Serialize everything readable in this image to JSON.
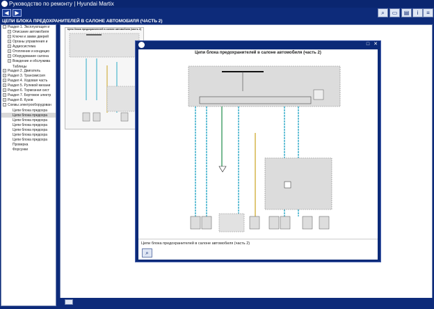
{
  "window": {
    "title": "Руководство по ремонту | Hyundai Martix"
  },
  "toolbar": {
    "back_icon": "arrow-left-icon",
    "forward_icon": "arrow-right-icon",
    "tools": [
      "zoom-icon",
      "image-icon",
      "print-icon",
      "info-icon",
      "menu-icon"
    ]
  },
  "page": {
    "header": "ЦЕПИ БЛОКА ПРЕДОХРАНИТЕЛЕЙ В САЛОНЕ АВТОМОБИЛЯ (ЧАСТЬ 2)"
  },
  "tree": {
    "items": [
      {
        "label": "Раздел 1. Эксплуатация и",
        "toggle": "-",
        "indent": 0
      },
      {
        "label": "Описание автомобиля",
        "toggle": "+",
        "indent": 1
      },
      {
        "label": "Ключи и замки дверей",
        "toggle": "+",
        "indent": 1
      },
      {
        "label": "Органы управления и",
        "toggle": "+",
        "indent": 1
      },
      {
        "label": "Аудиосистема",
        "toggle": "+",
        "indent": 1
      },
      {
        "label": "Отопление и кондицио",
        "toggle": "+",
        "indent": 1
      },
      {
        "label": "Оборудование салона",
        "toggle": "+",
        "indent": 1
      },
      {
        "label": "Вождение и обслужива",
        "toggle": "+",
        "indent": 1
      },
      {
        "label": "Таблицы",
        "toggle": "",
        "indent": 1
      },
      {
        "label": "Раздел 2. Двигатель",
        "toggle": "+",
        "indent": 0
      },
      {
        "label": "Раздел 3. Трансмиссия",
        "toggle": "+",
        "indent": 0
      },
      {
        "label": "Раздел 4. Ходовая часть",
        "toggle": "+",
        "indent": 0
      },
      {
        "label": "Раздел 5. Рулевой механи",
        "toggle": "+",
        "indent": 0
      },
      {
        "label": "Раздел 6. Тормозная сист",
        "toggle": "+",
        "indent": 0
      },
      {
        "label": "Раздел 7. Бортовое электр",
        "toggle": "+",
        "indent": 0
      },
      {
        "label": "Раздел 8. Кузов",
        "toggle": "+",
        "indent": 0
      },
      {
        "label": "Схемы электрооборудован",
        "toggle": "-",
        "indent": 0
      },
      {
        "label": "Цепи блока предохра",
        "toggle": "",
        "indent": 1
      },
      {
        "label": "Цепи блока предохра",
        "toggle": "",
        "indent": 1,
        "selected": true
      },
      {
        "label": "Цепи блока предохра",
        "toggle": "",
        "indent": 1
      },
      {
        "label": "Цепи блока предохра",
        "toggle": "",
        "indent": 1
      },
      {
        "label": "Цепи блока предохра",
        "toggle": "",
        "indent": 1
      },
      {
        "label": "Цепи блока предохра",
        "toggle": "",
        "indent": 1
      },
      {
        "label": "Цепи блока предохра",
        "toggle": "",
        "indent": 1
      },
      {
        "label": "Проверка",
        "toggle": "",
        "indent": 1
      },
      {
        "label": "Форсунки",
        "toggle": "",
        "indent": 1
      }
    ]
  },
  "thumbnail": {
    "title": "Цепи блока предохранителей в салоне автомобиля (часть 2)"
  },
  "popup": {
    "title": "",
    "diagram_title": "Цепи блока предохранителей в салоне автомобиля (часть 2)",
    "caption": "Цепи блока предохранителей в салоне автомобиля (часть 2)",
    "zoom_icon": "zoom-icon"
  },
  "colors": {
    "chrome": "#0d2b7a",
    "wire_cyan": "#2aa9c7",
    "wire_green": "#1c8a4a",
    "wire_yellow": "#c9a21e"
  }
}
